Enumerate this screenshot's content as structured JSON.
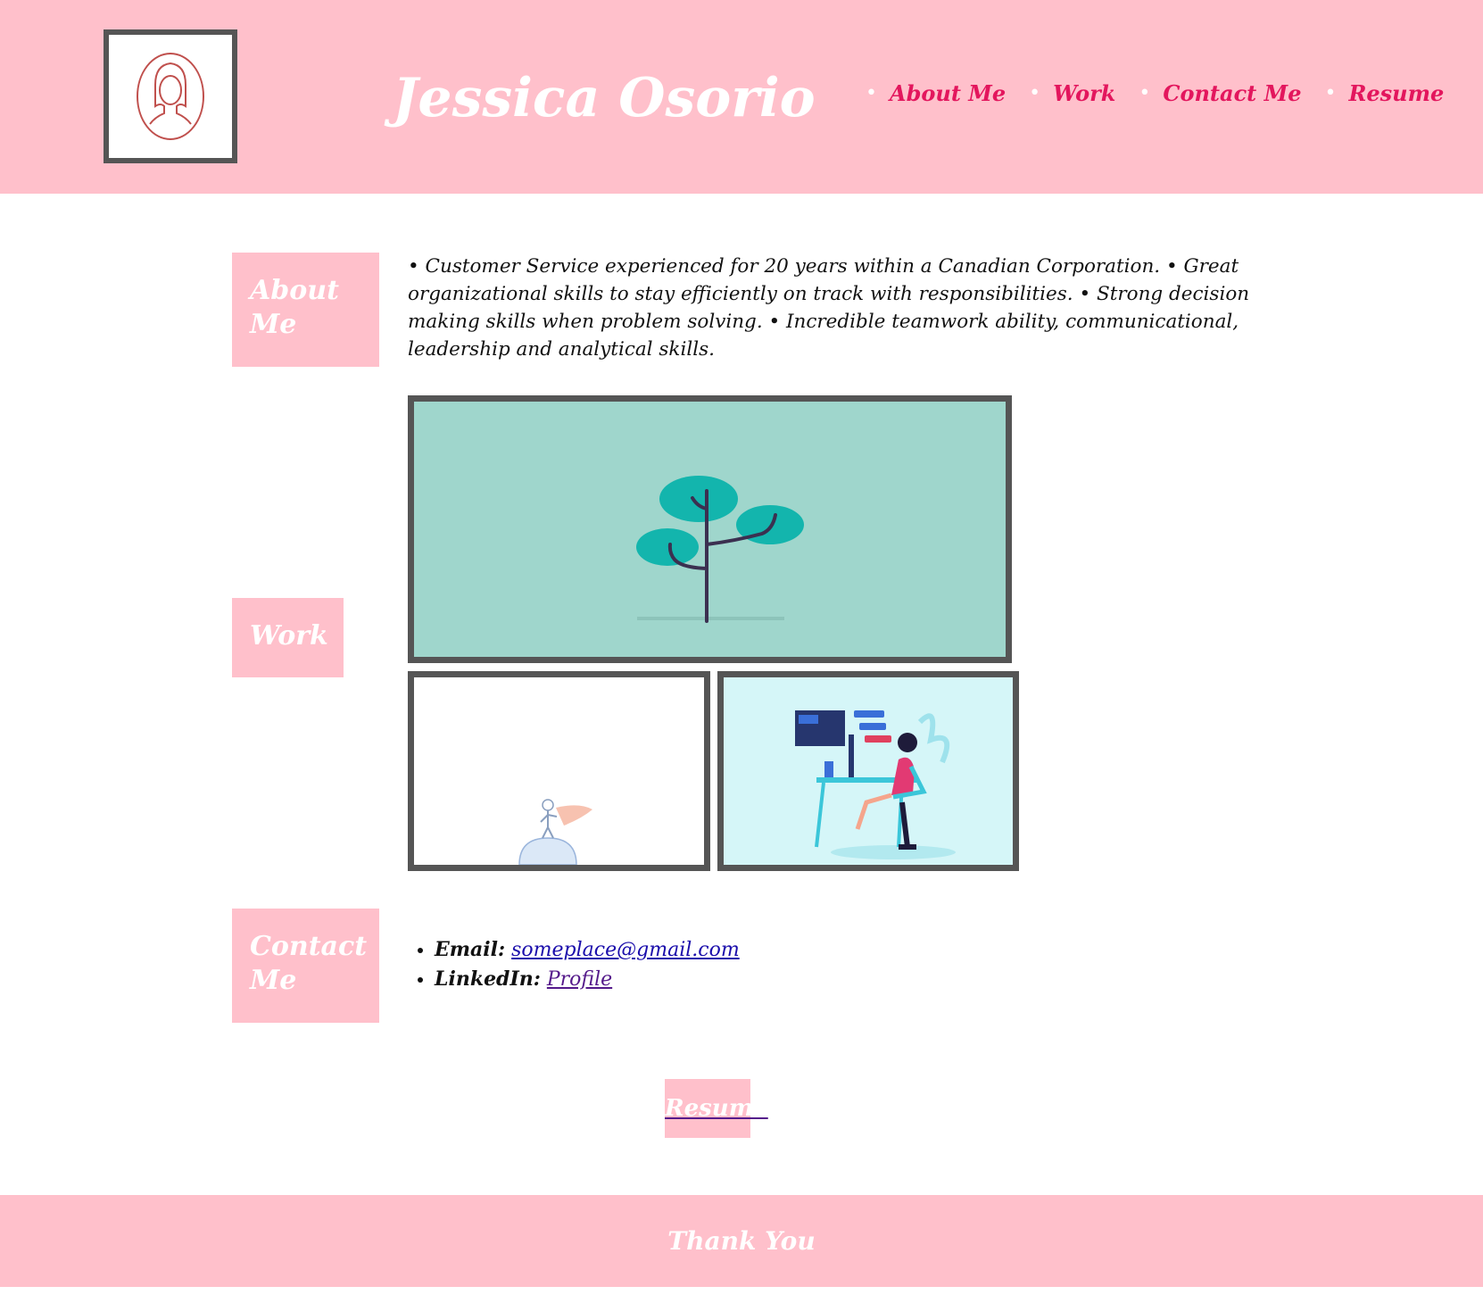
{
  "header": {
    "title": "Jessica Osorio",
    "logo_icon": "woman-portrait-icon",
    "nav": [
      {
        "label": "About Me"
      },
      {
        "label": "Work"
      },
      {
        "label": "Contact Me"
      },
      {
        "label": "Resume"
      }
    ]
  },
  "about": {
    "label": "About Me",
    "text": "• Customer Service experienced for 20 years within a Canadian Corporation. • Great organizational skills to stay efficiently on track with responsibilities. • Strong decision making skills when problem solving. • Incredible teamwork ability, communicational, leadership and analytical skills."
  },
  "work": {
    "label": "Work",
    "images": [
      {
        "icon": "tree-illustration"
      },
      {
        "icon": "superhero-globe-illustration"
      },
      {
        "icon": "woman-at-computer-illustration"
      }
    ]
  },
  "contact": {
    "label": "Contact Me",
    "email_label": "Email:",
    "email_value": "someplace@gmail.com",
    "linkedin_label": "LinkedIn:",
    "linkedin_value": "Profile"
  },
  "resume_button": "Resume",
  "footer": {
    "text": "Thank You"
  },
  "colors": {
    "brand_pink": "#ffc0cb",
    "nav_link": "#e3165d",
    "frame_border": "#555555",
    "teal_bg": "#9fd6cc"
  }
}
